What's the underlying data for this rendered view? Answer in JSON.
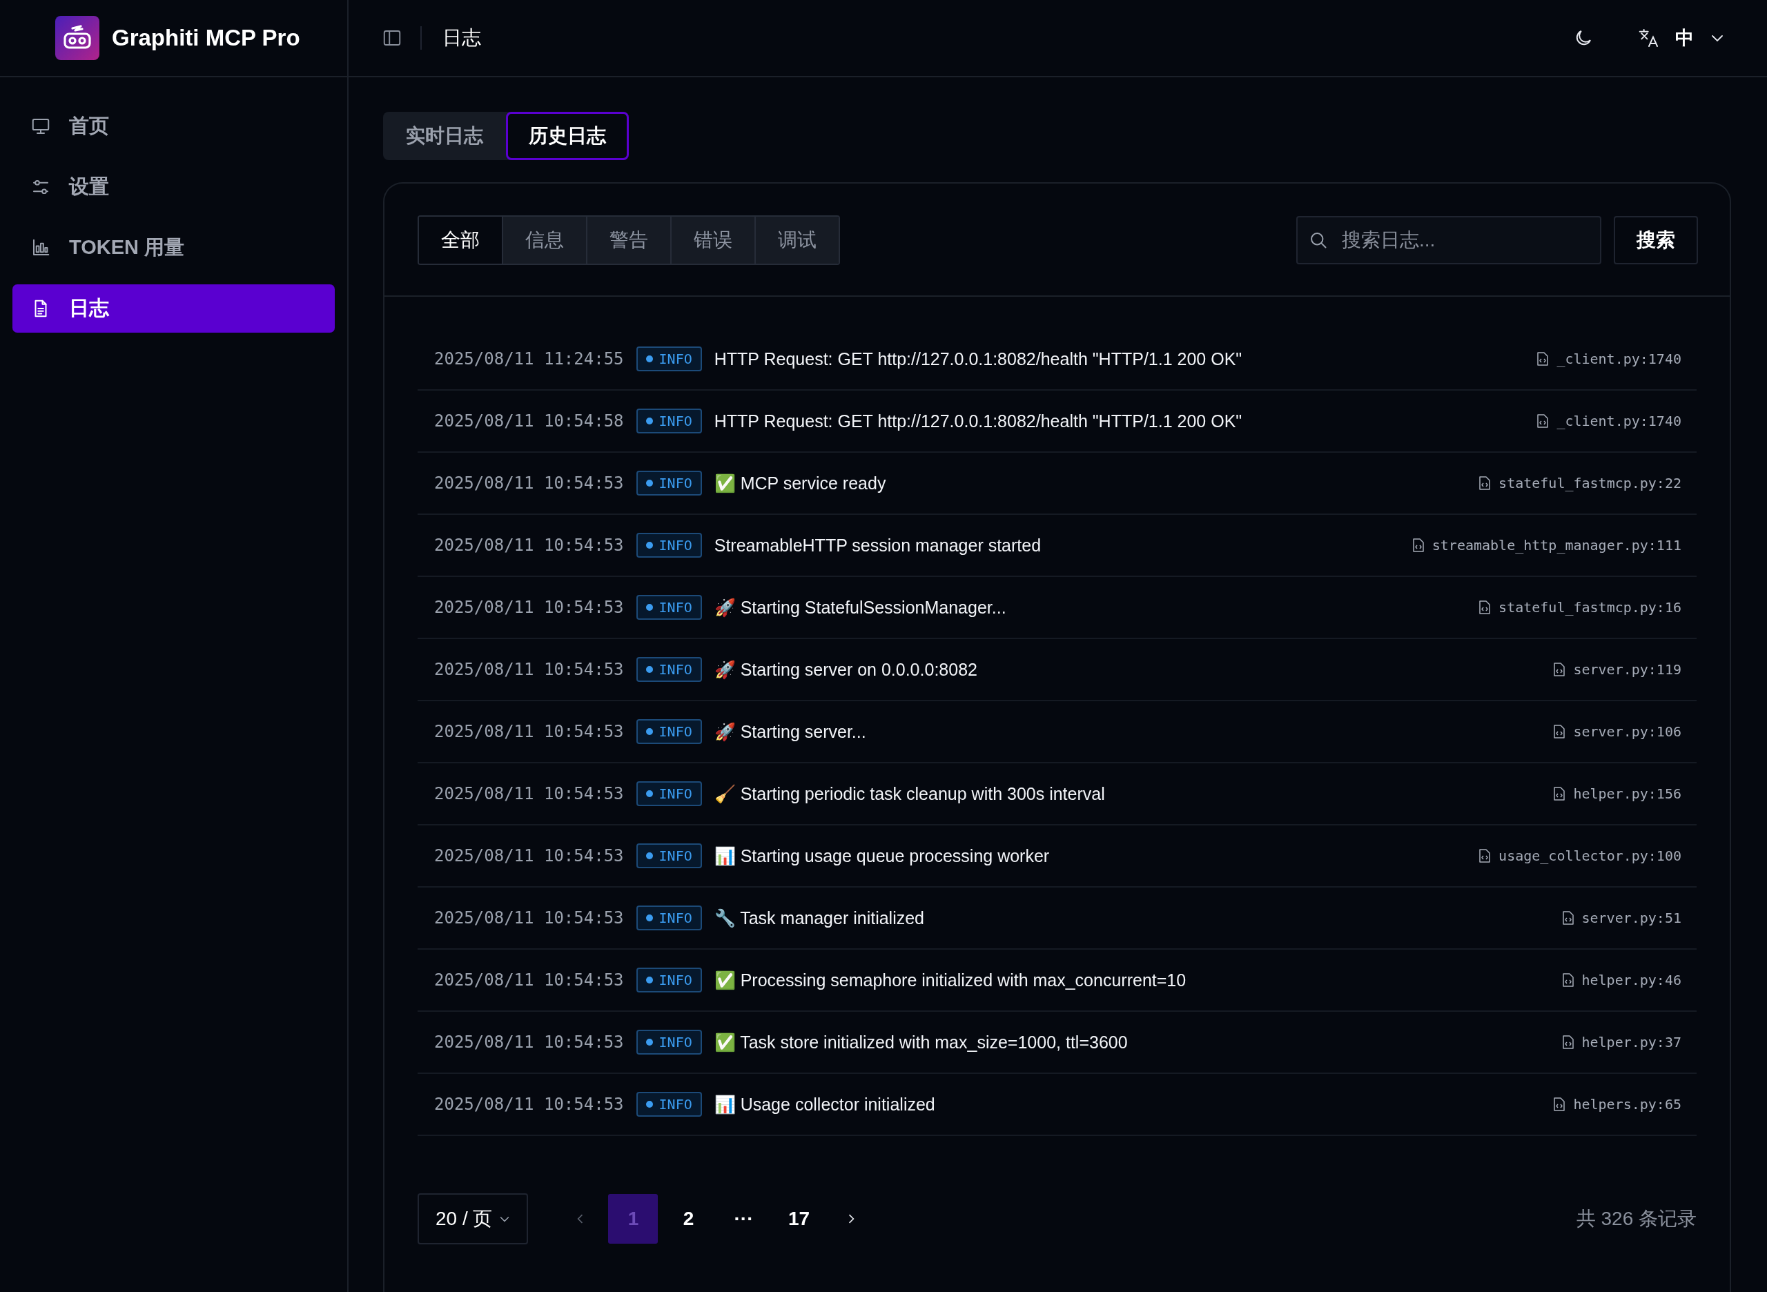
{
  "brand": {
    "name": "Graphiti MCP Pro"
  },
  "sidebar": {
    "items": [
      {
        "label": "首页",
        "selected": false
      },
      {
        "label": "设置",
        "selected": false
      },
      {
        "label": "TOKEN 用量",
        "selected": false
      },
      {
        "label": "日志",
        "selected": true
      }
    ]
  },
  "header": {
    "title": "日志",
    "language": "中"
  },
  "view_tabs": [
    {
      "label": "实时日志",
      "selected": false
    },
    {
      "label": "历史日志",
      "selected": true
    }
  ],
  "level_filters": [
    {
      "label": "全部",
      "selected": true
    },
    {
      "label": "信息",
      "selected": false
    },
    {
      "label": "警告",
      "selected": false
    },
    {
      "label": "错误",
      "selected": false
    },
    {
      "label": "调试",
      "selected": false
    }
  ],
  "search": {
    "placeholder": "搜索日志...",
    "button": "搜索"
  },
  "logs": [
    {
      "time": "2025/08/11 11:24:55",
      "level": "INFO",
      "message": "HTTP Request: GET http://127.0.0.1:8082/health \"HTTP/1.1 200 OK\"",
      "source": "_client.py:1740"
    },
    {
      "time": "2025/08/11 10:54:58",
      "level": "INFO",
      "message": "HTTP Request: GET http://127.0.0.1:8082/health \"HTTP/1.1 200 OK\"",
      "source": "_client.py:1740"
    },
    {
      "time": "2025/08/11 10:54:53",
      "level": "INFO",
      "message": "✅ MCP service ready",
      "source": "stateful_fastmcp.py:22"
    },
    {
      "time": "2025/08/11 10:54:53",
      "level": "INFO",
      "message": "StreamableHTTP session manager started",
      "source": "streamable_http_manager.py:111"
    },
    {
      "time": "2025/08/11 10:54:53",
      "level": "INFO",
      "message": "🚀 Starting StatefulSessionManager...",
      "source": "stateful_fastmcp.py:16"
    },
    {
      "time": "2025/08/11 10:54:53",
      "level": "INFO",
      "message": "🚀 Starting server on 0.0.0.0:8082",
      "source": "server.py:119"
    },
    {
      "time": "2025/08/11 10:54:53",
      "level": "INFO",
      "message": "🚀 Starting server...",
      "source": "server.py:106"
    },
    {
      "time": "2025/08/11 10:54:53",
      "level": "INFO",
      "message": "🧹 Starting periodic task cleanup with 300s interval",
      "source": "helper.py:156"
    },
    {
      "time": "2025/08/11 10:54:53",
      "level": "INFO",
      "message": "📊 Starting usage queue processing worker",
      "source": "usage_collector.py:100"
    },
    {
      "time": "2025/08/11 10:54:53",
      "level": "INFO",
      "message": "🔧 Task manager initialized",
      "source": "server.py:51"
    },
    {
      "time": "2025/08/11 10:54:53",
      "level": "INFO",
      "message": "✅ Processing semaphore initialized with max_concurrent=10",
      "source": "helper.py:46"
    },
    {
      "time": "2025/08/11 10:54:53",
      "level": "INFO",
      "message": "✅ Task store initialized with max_size=1000, ttl=3600",
      "source": "helper.py:37"
    },
    {
      "time": "2025/08/11 10:54:53",
      "level": "INFO",
      "message": "📊 Usage collector initialized",
      "source": "helpers.py:65"
    }
  ],
  "pagination": {
    "page_size": "20 / 页",
    "pages": [
      {
        "label": "1",
        "kind": "page",
        "selected": true
      },
      {
        "label": "2",
        "kind": "page",
        "selected": false
      },
      {
        "label": "···",
        "kind": "ellipsis"
      },
      {
        "label": "17",
        "kind": "page",
        "selected": false
      }
    ],
    "total": "共 326 条记录"
  }
}
